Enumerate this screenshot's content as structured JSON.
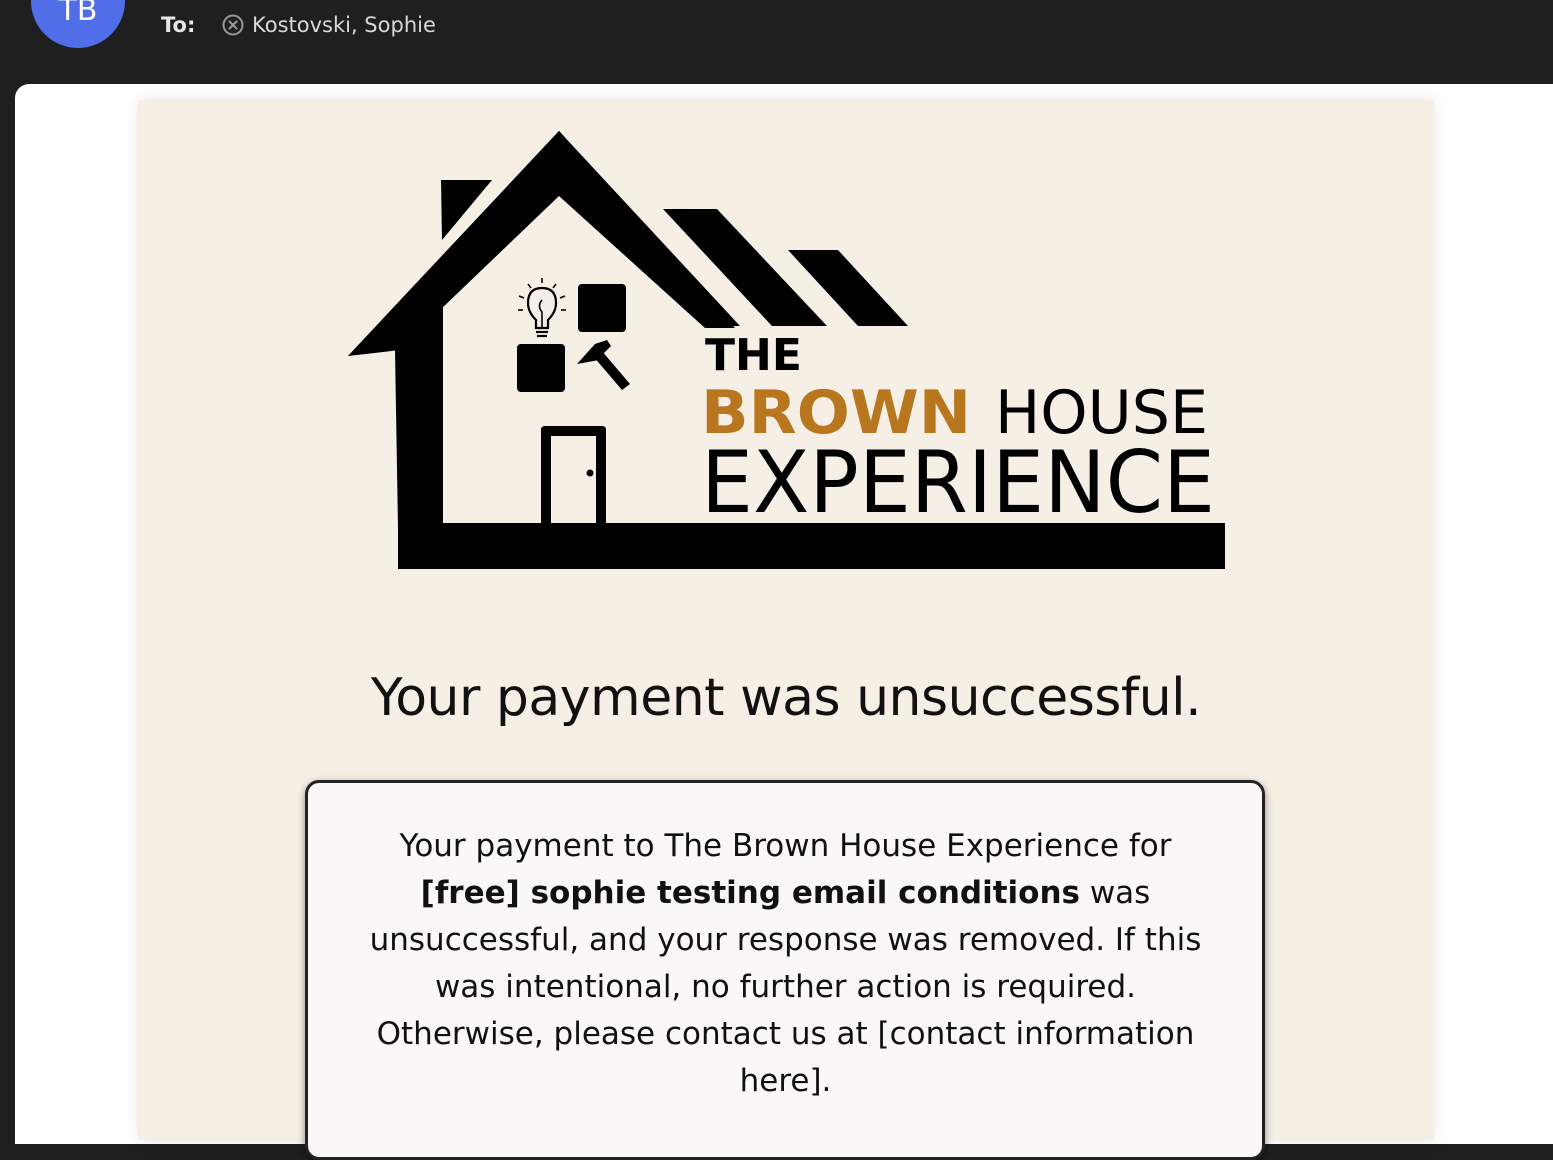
{
  "header": {
    "avatar_initials": "TB",
    "to_label": "To:",
    "recipient": "Kostovski, Sophie"
  },
  "email": {
    "logo": {
      "word_the": "THE",
      "word_brown": "BROWN",
      "word_house": "HOUSE",
      "word_experience": "EXPERIENCE"
    },
    "headline": "Your payment was unsuccessful.",
    "message": {
      "part1": "Your payment to The Brown House Experience for",
      "event_name": "[free] sophie testing email conditions",
      "part2": "was unsuccessful, and your response was removed. If this was intentional, no further action is required. Otherwise, please contact us at [contact information here]."
    }
  },
  "colors": {
    "chrome_background": "#1f1f20",
    "avatar": "#4f6ee8",
    "email_background": "#f6efe6",
    "brand_brown": "#b8761f",
    "card_background": "#f9f8f6"
  }
}
